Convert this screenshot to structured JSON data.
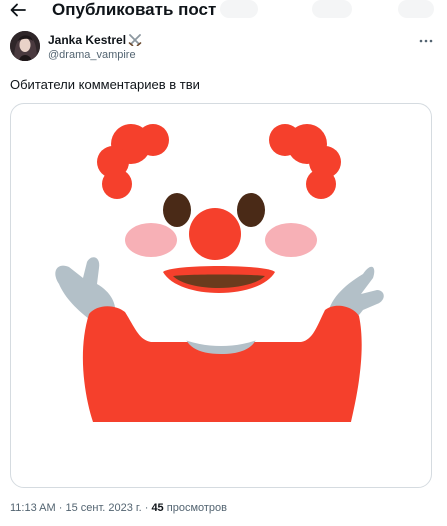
{
  "header": {
    "title": "Опубликовать пост",
    "back_icon": "arrow-left-icon"
  },
  "author": {
    "name": "Janka Kestrel",
    "name_emoji_icon": "crossed-swords-icon",
    "handle": "@drama_vampire",
    "more_icon": "more-horizontal-icon"
  },
  "tweet": {
    "text": "Обитатели комментариев в тви",
    "media": {
      "icon": "clown-shrug-emoji"
    }
  },
  "meta": {
    "time": "11:13 AM",
    "separator": "·",
    "date": "15 сент. 2023 г.",
    "views_count": "45",
    "views_label": "просмотров"
  },
  "colors": {
    "text_primary": "#0f1419",
    "text_secondary": "#536471",
    "border": "#d5dbe0",
    "clown_red": "#f5402c",
    "clown_white": "#ffffff",
    "arm_gray": "#b3c0c8"
  }
}
